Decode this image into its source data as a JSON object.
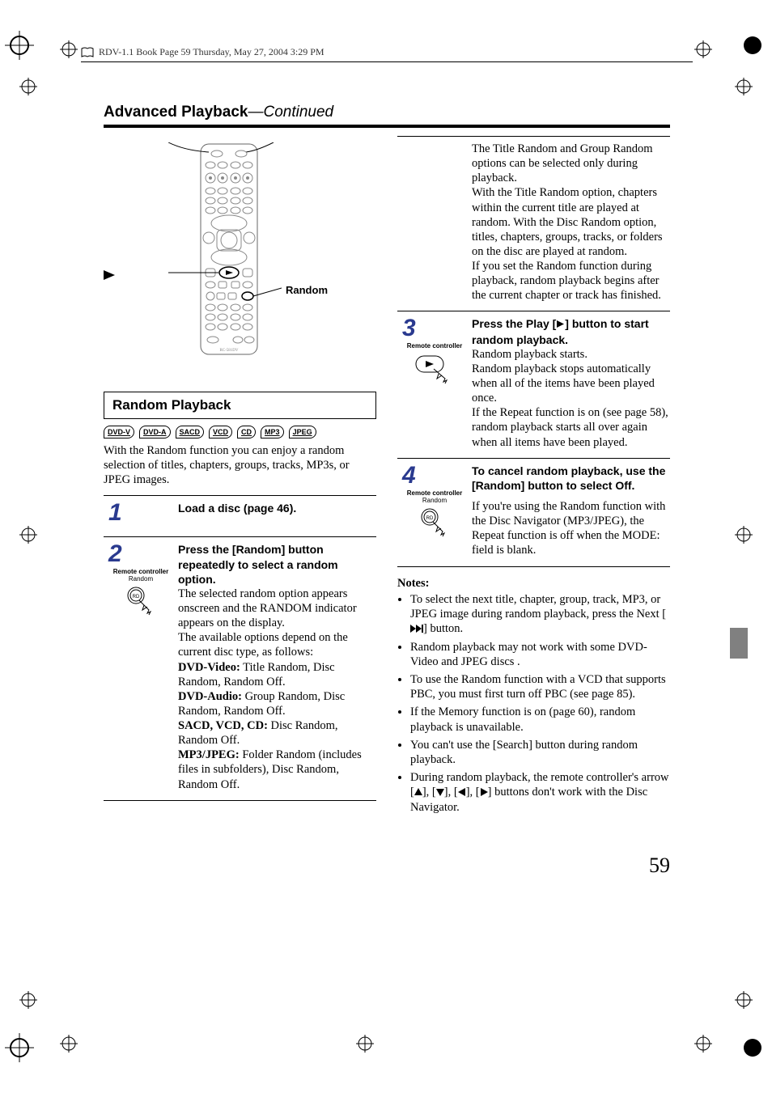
{
  "meta_header": "RDV-1.1 Book Page 59 Thursday, May 27, 2004 3:29 PM",
  "section": {
    "title": "Advanced Playback",
    "sep": "—",
    "continued": "Continued"
  },
  "remote": {
    "random_label": "Random",
    "model": "RC-581DV"
  },
  "subsection": {
    "title": "Random Playback"
  },
  "badges": [
    "DVD-V",
    "DVD-A",
    "SACD",
    "VCD",
    "CD",
    "MP3",
    "JPEG"
  ],
  "intro": "With the Random function you can enjoy a random selection of titles, chapters, groups, tracks, MP3s, or JPEG images.",
  "steps": {
    "s1": {
      "num": "1",
      "title": "Load a disc (page 46)."
    },
    "s2": {
      "num": "2",
      "subtitle": "Remote controller",
      "icon_label": "Random",
      "title": "Press the [Random] button repeatedly to select a random option.",
      "p1": "The selected random option appears onscreen and the RANDOM indicator appears on the display.",
      "p2": "The available options depend on the current disc type, as follows:",
      "o1l": "DVD-Video:",
      "o1": " Title Random, Disc Random, Random Off.",
      "o2l": "DVD-Audio:",
      "o2": " Group Random, Disc Random, Random Off.",
      "o3l": "SACD, VCD, CD:",
      "o3": " Disc Random, Random Off.",
      "o4l": "MP3/JPEG:",
      "o4": " Folder Random (includes files in subfolders), Disc Random, Random Off."
    },
    "s2b": {
      "p1": "The Title Random and Group Random options can be selected only during playback.",
      "p2": "With the Title Random option, chapters within the current title are played at random. With the Disc Random option, titles, chapters, groups, tracks, or folders on the disc are played at random.",
      "p3": "If you set the Random function during playback, random playback begins after the current chapter or track has finished."
    },
    "s3": {
      "num": "3",
      "subtitle": "Remote controller",
      "title_a": "Press the Play [",
      "title_b": "] button to start random playback.",
      "p1": "Random playback starts.",
      "p2": "Random playback stops automatically when all of the items have been played once.",
      "p3": "If the Repeat function is on (see page 58), random playback starts all over again when all items have been played."
    },
    "s4": {
      "num": "4",
      "subtitle": "Remote controller",
      "icon_label": "Random",
      "title": "To cancel random playback, use the [Random] button to select Off.",
      "p1": "If you're using the Random function with the Disc Navigator (MP3/JPEG), the Repeat function is off when the MODE: field is blank."
    }
  },
  "notes": {
    "head": "Notes:",
    "n1a": "To select the next title, chapter, group, track, MP3, or JPEG image during random playback, press the Next [",
    "n1b": "] button.",
    "n2": "Random playback may not work with some DVD-Video and JPEG discs .",
    "n3": "To use the Random function with a VCD that supports PBC, you must first turn off PBC (see page 85).",
    "n4": "If the Memory function is on (page 60), random playback is unavailable.",
    "n5": "You can't use the [Search] button during random playback.",
    "n6a": "During random playback, the remote controller's arrow [",
    "n6b": "], [",
    "n6c": "], [",
    "n6d": "], [",
    "n6e": "] buttons don't work with the Disc Navigator."
  },
  "page_number": "59"
}
